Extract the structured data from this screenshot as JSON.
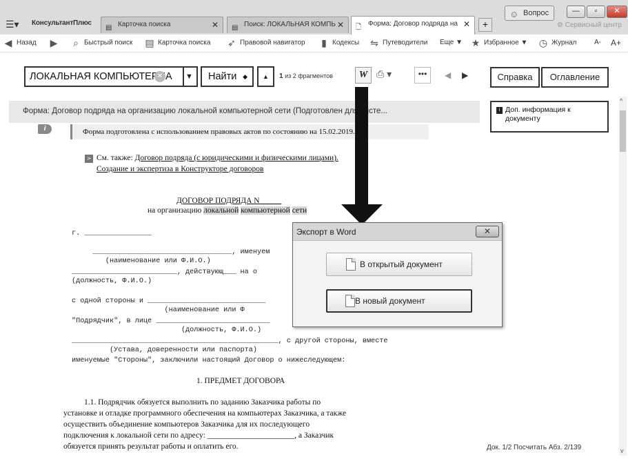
{
  "window": {
    "app_name": "КонсультантПлюс",
    "question_btn": "Вопрос",
    "service_center": "Сервисный центр",
    "tabs": [
      {
        "label": "Карточка поиска"
      },
      {
        "label": "Поиск: ЛОКАЛЬНАЯ КОМПЬ"
      },
      {
        "label": "Форма: Договор подряда на"
      }
    ]
  },
  "toolbar": {
    "back": "Назад",
    "quick_search": "Быстрый поиск",
    "search_card": "Карточка поиска",
    "legal_nav": "Правовой навигатор",
    "codes": "Кодексы",
    "guides": "Путеводители",
    "more": "Еще ▼",
    "favorites": "Избранное ▼",
    "journal": "Журнал",
    "font_minus": "A-",
    "font_plus": "A+"
  },
  "search": {
    "query": "ЛОКАЛЬНАЯ КОМПЬЮТЕРНА",
    "find_label": "Найти",
    "fragments_num": "1",
    "fragments_text": " из 2 фрагментов"
  },
  "right": {
    "help": "Справка",
    "toc": "Оглавление",
    "extra_info": "Доп. информация к документу",
    "status": "Док. 1/2   Посчитать Абз. 2/139"
  },
  "document": {
    "title": "Форма: Договор подряда на организацию локальной компьютерной сети (Подготовлен для систе...",
    "prepared": "Форма подготовлена с использованием правовых актов по состоянию на 15.02.2019.",
    "see_also_prefix": "См. также: ",
    "see_also_link1": "Договор подряда (с юридическими и физическими лицами).",
    "see_also_link2": "Создание и экспертиза в Конструкторе договоров",
    "contract_title": "ДОГОВОР ПОДРЯДА N _____",
    "contract_sub_a": "на организацию ",
    "contract_sub_hl1": "локальной",
    "contract_sub_hl2": "компьютерной",
    "contract_sub_hl3": "сети",
    "mono_lines": [
      "г. ________________",
      "     _________________________________, именуем",
      "        (наименование или Ф.И.О.)",
      "_________________________, действующ___ на о",
      "(должность, Ф.И.О.)",
      "с одной стороны и ____________________________",
      "                      (наименование или Ф",
      "\"Подрядчик\", в лице ___________________________",
      "                          (должность, Ф.И.О.)",
      "_________________________________________________, с другой стороны, вместе",
      "         (Устава, доверенности или паспорта)",
      "именуемые \"Стороны\", заключили настоящий Договор о нижеследующем:"
    ],
    "section1": "1. ПРЕДМЕТ ДОГОВОРА",
    "para_lines": [
      "1.1.  Подрядчик  обязуется  выполнить  по  заданию  Заказчика  работы  по",
      "установке и отладке программного обеспечения на компьютерах Заказчика, а также",
      "осуществить   объединение   компьютеров   Заказчика   для   их   последующего",
      "подключения к локальной сети по адресу: ______________________, а Заказчик",
      "обязуется принять результат работы и оплатить его."
    ]
  },
  "dialog": {
    "title": "Экспорт в Word",
    "open_doc": "В открытый документ",
    "new_doc": "В новый документ"
  }
}
